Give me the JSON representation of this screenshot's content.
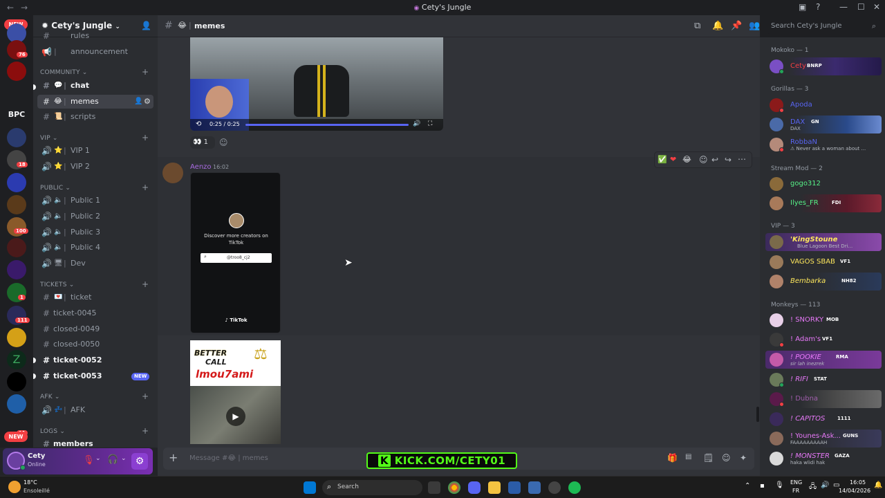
{
  "window": {
    "title": "Cety's Jungle"
  },
  "server": {
    "name": "Cety's Jungle",
    "rail_new_top": "NEW",
    "rail_new_bottom": "NEW",
    "rail_bpc": "BPC",
    "badges": [
      "76",
      "18",
      "100",
      "1",
      "111",
      "11"
    ]
  },
  "channels": {
    "top_item": "rules",
    "announcement": "announcement",
    "categories": {
      "community": "COMMUNITY",
      "vip": "VIP",
      "public": "PUBLIC",
      "tickets": "TICKETS",
      "afk": "AFK",
      "logs": "LOGS"
    },
    "chat": "chat",
    "memes": "memes",
    "scripts": "scripts",
    "vip1": "VIP 1",
    "vip2": "VIP 2",
    "public1": "Public 1",
    "public2": "Public 2",
    "public3": "Public 3",
    "public4": "Public 4",
    "dev": "Dev",
    "ticket": "ticket",
    "ticket0045": "ticket-0045",
    "closed0049": "closed-0049",
    "closed0050": "closed-0050",
    "ticket0052": "ticket-0052",
    "ticket0053": "ticket-0053",
    "new_badge": "NEW",
    "afk": "AFK",
    "members": "members"
  },
  "user": {
    "name": "Cety",
    "status": "Online"
  },
  "header": {
    "channel": "memes",
    "search_placeholder": "Search Cety's Jungle"
  },
  "messages": {
    "video_time": "0:25 / 0:25",
    "reaction_count": "1",
    "author": "Aenzo",
    "timestamp": "16:02",
    "tiktok_text": "Discover more creators on TikTok",
    "tiktok_search": "@troo8_cj2",
    "tiktok_brand": "TikTok",
    "meme_line1": "BETTER",
    "meme_line2": "CALL",
    "meme_line3": "lmou7ami"
  },
  "composer": {
    "placeholder": "Message #😂 | memes"
  },
  "overlay": {
    "kick": "KICK.COM/CETY01"
  },
  "member_list": {
    "groups": [
      {
        "title": "Mokoko — 1"
      },
      {
        "title": "Gorillas — 3"
      },
      {
        "title": "Stream Mod — 2"
      },
      {
        "title": "VIP — 3"
      },
      {
        "title": "Monkeys — 113"
      }
    ],
    "members": [
      {
        "name": "Cety",
        "tag": "BNRP",
        "color": "#f23f43"
      },
      {
        "name": "Apoda",
        "color": "#5865f2"
      },
      {
        "name": "DAX",
        "tag": "GN",
        "status": "DAX",
        "color": "#5865f2"
      },
      {
        "name": "RobbaN",
        "status": "⚠ Never ask a woman about ...",
        "color": "#5865f2"
      },
      {
        "name": "gogo312",
        "color": "#57f287"
      },
      {
        "name": "Ilyes_FR",
        "tag": "FDI",
        "color": "#57f287"
      },
      {
        "name": "'KingStoune",
        "status": "Blue Lagoon Best Dri...",
        "color": "#fee75c"
      },
      {
        "name": "VAGOS SBAB",
        "tag": "VF1",
        "color": "#fee75c"
      },
      {
        "name": "Bembarka",
        "tag": "NH82",
        "color": "#fee75c"
      },
      {
        "name": "! SNORKY",
        "tag": "MOB",
        "color": "#e879f9"
      },
      {
        "name": "! Adam's",
        "tag": "VF1",
        "color": "#e879f9"
      },
      {
        "name": "! POOKIE",
        "tag": "RMA",
        "status": "sir lah inezrek",
        "color": "#e879f9"
      },
      {
        "name": "! RIFI",
        "tag": "STAT",
        "color": "#e879f9"
      },
      {
        "name": "! Dubna",
        "color": "#e879f9"
      },
      {
        "name": "! CAPITOS",
        "tag": "1111",
        "color": "#e879f9"
      },
      {
        "name": "! Younes-Ask...",
        "tag": "GUNS",
        "status": "FAAAAAAAAAH",
        "color": "#e879f9"
      },
      {
        "name": "! MONSTER",
        "tag": "GAZA",
        "status": "haka wlidi hak",
        "color": "#e879f9"
      }
    ]
  },
  "taskbar": {
    "weather_temp": "18°C",
    "weather_desc": "Ensoleillé",
    "search": "Search",
    "lang_top": "ENG",
    "lang_bottom": "FR",
    "time": "16:05",
    "date": "14/04/2026"
  }
}
